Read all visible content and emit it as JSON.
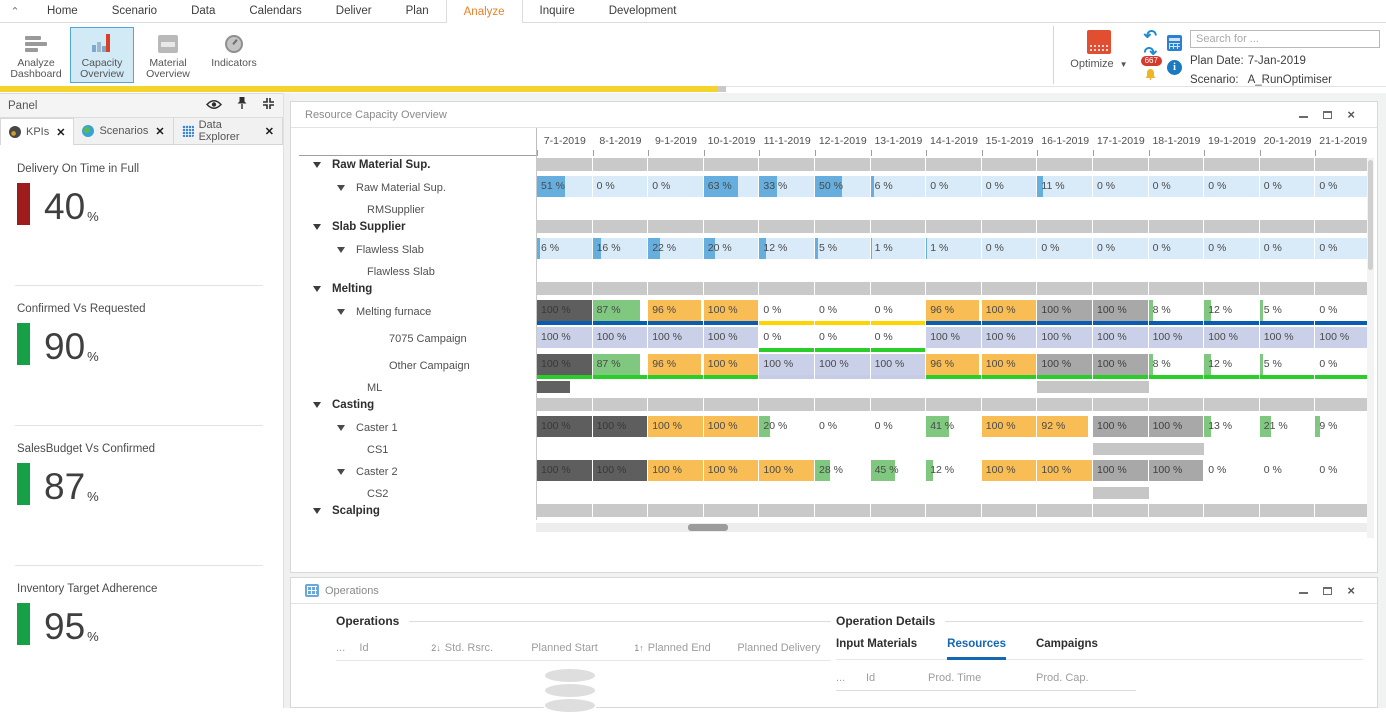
{
  "menubar": {
    "items": [
      "Home",
      "Scenario",
      "Data",
      "Calendars",
      "Deliver",
      "Plan",
      "Analyze",
      "Inquire",
      "Development"
    ],
    "active": "Analyze"
  },
  "ribbon": {
    "buttons": [
      {
        "label": "Analyze Dashboard",
        "icon": "dashboard-icon",
        "selected": false
      },
      {
        "label": "Capacity Overview",
        "icon": "capacity-chart-icon",
        "selected": true
      },
      {
        "label": "Material Overview",
        "icon": "material-box-icon",
        "selected": false
      },
      {
        "label": "Indicators",
        "icon": "gauge-icon",
        "selected": false
      }
    ],
    "optimize_label": "Optimize",
    "notification_badge": "667",
    "search_placeholder": "Search for ...",
    "plan_date_label": "Plan Date:",
    "plan_date_value": "7-Jan-2019",
    "scenario_label": "Scenario:",
    "scenario_value": "A_RunOptimiser"
  },
  "left_panel": {
    "title": "Panel",
    "tabs": [
      {
        "label": "KPIs",
        "icon": "kpi-gauge"
      },
      {
        "label": "Scenarios",
        "icon": "globe"
      },
      {
        "label": "Data Explorer",
        "icon": "data-grid"
      }
    ],
    "active_tab": "KPIs",
    "kpis": [
      {
        "label": "Delivery On Time in Full",
        "value": "40",
        "unit": "%",
        "color": "#9e1c1c"
      },
      {
        "label": "Confirmed Vs Requested",
        "value": "90",
        "unit": "%",
        "color": "#18a048"
      },
      {
        "label": "SalesBudget Vs Confirmed",
        "value": "87",
        "unit": "%",
        "color": "#18a048"
      },
      {
        "label": "Inventory Target Adherence",
        "value": "95",
        "unit": "%",
        "color": "#18a048"
      }
    ]
  },
  "capacity_panel": {
    "title": "Resource Capacity Overview",
    "dates": [
      "7-1-2019",
      "8-1-2019",
      "9-1-2019",
      "10-1-2019",
      "11-1-2019",
      "12-1-2019",
      "13-1-2019",
      "14-1-2019",
      "15-1-2019",
      "16-1-2019",
      "17-1-2019",
      "18-1-2019",
      "19-1-2019",
      "20-1-2019",
      "21-1-2019"
    ],
    "legend_colors": {
      "blue_track": "#d9ebf9",
      "blue_fill": "#66aede",
      "orange": "#f9bd55",
      "green": "#80c780",
      "gray": "#a8a8a8",
      "dark": "#5e5e5e",
      "lavender": "#cad0e8",
      "group_bar": "#c9c9c9",
      "underline_blue": "#0a5cb0",
      "underline_yellow": "#ffd400",
      "underline_green": "#2bcd2b",
      "underline_lavender": "#c6cbe6"
    },
    "rows": [
      {
        "kind": "group",
        "label": "Raw Material Sup."
      },
      {
        "kind": "capacity",
        "label": "Raw Material Sup.",
        "level": "resource",
        "cells": [
          {
            "v": 51,
            "s": "blue"
          },
          {
            "v": 0,
            "s": "blue"
          },
          {
            "v": 0,
            "s": "blue"
          },
          {
            "v": 63,
            "s": "blue"
          },
          {
            "v": 33,
            "s": "blue"
          },
          {
            "v": 50,
            "s": "blue"
          },
          {
            "v": 6,
            "s": "blue"
          },
          {
            "v": 0,
            "s": "blue"
          },
          {
            "v": 0,
            "s": "blue"
          },
          {
            "v": 11,
            "s": "blue"
          },
          {
            "v": 0,
            "s": "blue"
          },
          {
            "v": 0,
            "s": "blue"
          },
          {
            "v": 0,
            "s": "blue"
          },
          {
            "v": 0,
            "s": "blue"
          },
          {
            "v": 0,
            "s": "blue"
          }
        ]
      },
      {
        "kind": "name",
        "label": "RMSupplier",
        "segments": []
      },
      {
        "kind": "group",
        "label": "Slab Supplier"
      },
      {
        "kind": "capacity",
        "label": "Flawless Slab",
        "level": "resource",
        "cells": [
          {
            "v": 6,
            "s": "blue"
          },
          {
            "v": 16,
            "s": "blue"
          },
          {
            "v": 22,
            "s": "blue"
          },
          {
            "v": 20,
            "s": "blue"
          },
          {
            "v": 12,
            "s": "blue"
          },
          {
            "v": 5,
            "s": "blue"
          },
          {
            "v": 1,
            "s": "blue"
          },
          {
            "v": 1,
            "s": "blue"
          },
          {
            "v": 0,
            "s": "blue"
          },
          {
            "v": 0,
            "s": "blue"
          },
          {
            "v": 0,
            "s": "blue"
          },
          {
            "v": 0,
            "s": "blue"
          },
          {
            "v": 0,
            "s": "blue"
          },
          {
            "v": 0,
            "s": "blue"
          },
          {
            "v": 0,
            "s": "blue"
          }
        ]
      },
      {
        "kind": "name",
        "label": "Flawless Slab",
        "segments": []
      },
      {
        "kind": "group",
        "label": "Melting"
      },
      {
        "kind": "capacity",
        "label": "Melting furnace",
        "level": "resource",
        "cells": [
          {
            "v": 100,
            "s": "dark"
          },
          {
            "v": 87,
            "s": "green"
          },
          {
            "v": 96,
            "s": "orange"
          },
          {
            "v": 100,
            "s": "orange"
          },
          {
            "v": 0,
            "s": "plain"
          },
          {
            "v": 0,
            "s": "plain"
          },
          {
            "v": 0,
            "s": "plain"
          },
          {
            "v": 96,
            "s": "orange"
          },
          {
            "v": 100,
            "s": "orange"
          },
          {
            "v": 100,
            "s": "gray"
          },
          {
            "v": 100,
            "s": "gray"
          },
          {
            "v": 8,
            "s": "green"
          },
          {
            "v": 12,
            "s": "green"
          },
          {
            "v": 5,
            "s": "green"
          },
          {
            "v": 0,
            "s": "plain"
          }
        ],
        "underline": [
          "b",
          "b",
          "b",
          "b",
          "y",
          "y",
          "y",
          "b",
          "b",
          "b",
          "b",
          "b",
          "b",
          "b",
          "b"
        ]
      },
      {
        "kind": "capacity",
        "label": "7075 Campaign",
        "level": "campaign",
        "cells": [
          {
            "v": 100,
            "s": "lav"
          },
          {
            "v": 100,
            "s": "lav"
          },
          {
            "v": 100,
            "s": "lav"
          },
          {
            "v": 100,
            "s": "lav"
          },
          {
            "v": 0,
            "s": "plain"
          },
          {
            "v": 0,
            "s": "plain"
          },
          {
            "v": 0,
            "s": "plain"
          },
          {
            "v": 100,
            "s": "lav"
          },
          {
            "v": 100,
            "s": "lav"
          },
          {
            "v": 100,
            "s": "lav"
          },
          {
            "v": 100,
            "s": "lav"
          },
          {
            "v": 100,
            "s": "lav"
          },
          {
            "v": 100,
            "s": "lav"
          },
          {
            "v": 100,
            "s": "lav"
          },
          {
            "v": 100,
            "s": "lav"
          }
        ],
        "underline": [
          "",
          "",
          "",
          "",
          "g",
          "g",
          "g",
          "",
          "",
          "",
          "",
          "",
          "",
          "",
          ""
        ]
      },
      {
        "kind": "capacity",
        "label": "Other Campaign",
        "level": "campaign",
        "cells": [
          {
            "v": 100,
            "s": "dark"
          },
          {
            "v": 87,
            "s": "green"
          },
          {
            "v": 96,
            "s": "orange"
          },
          {
            "v": 100,
            "s": "orange"
          },
          {
            "v": 100,
            "s": "lav"
          },
          {
            "v": 100,
            "s": "lav"
          },
          {
            "v": 100,
            "s": "lav"
          },
          {
            "v": 96,
            "s": "orange"
          },
          {
            "v": 100,
            "s": "orange"
          },
          {
            "v": 100,
            "s": "gray"
          },
          {
            "v": 100,
            "s": "gray"
          },
          {
            "v": 8,
            "s": "green"
          },
          {
            "v": 12,
            "s": "green"
          },
          {
            "v": 5,
            "s": "green"
          },
          {
            "v": 0,
            "s": "plain"
          }
        ],
        "underline": [
          "g",
          "g",
          "g",
          "g",
          "l",
          "l",
          "l",
          "g",
          "g",
          "g",
          "g",
          "g",
          "g",
          "g",
          "g"
        ]
      },
      {
        "kind": "name",
        "label": "ML",
        "segments": [
          {
            "col": 0,
            "span": 1,
            "fill": 60,
            "tone": "dark"
          },
          {
            "col": 9,
            "span": 2,
            "fill": 100,
            "tone": "light"
          }
        ]
      },
      {
        "kind": "group",
        "label": "Casting"
      },
      {
        "kind": "capacity",
        "label": "Caster 1",
        "level": "resource",
        "cells": [
          {
            "v": 100,
            "s": "dark"
          },
          {
            "v": 100,
            "s": "dark"
          },
          {
            "v": 100,
            "s": "orange"
          },
          {
            "v": 100,
            "s": "orange"
          },
          {
            "v": 20,
            "s": "green"
          },
          {
            "v": 0,
            "s": "plain"
          },
          {
            "v": 0,
            "s": "plain"
          },
          {
            "v": 41,
            "s": "green"
          },
          {
            "v": 100,
            "s": "orange"
          },
          {
            "v": 92,
            "s": "orange"
          },
          {
            "v": 100,
            "s": "gray"
          },
          {
            "v": 100,
            "s": "gray"
          },
          {
            "v": 13,
            "s": "green"
          },
          {
            "v": 21,
            "s": "green"
          },
          {
            "v": 9,
            "s": "green"
          }
        ]
      },
      {
        "kind": "name",
        "label": "CS1",
        "segments": [
          {
            "col": 10,
            "span": 2,
            "fill": 100,
            "tone": "light"
          }
        ]
      },
      {
        "kind": "capacity",
        "label": "Caster 2",
        "level": "resource",
        "cells": [
          {
            "v": 100,
            "s": "dark"
          },
          {
            "v": 100,
            "s": "dark"
          },
          {
            "v": 100,
            "s": "orange"
          },
          {
            "v": 100,
            "s": "orange"
          },
          {
            "v": 100,
            "s": "orange"
          },
          {
            "v": 28,
            "s": "green"
          },
          {
            "v": 45,
            "s": "green"
          },
          {
            "v": 12,
            "s": "green"
          },
          {
            "v": 100,
            "s": "orange"
          },
          {
            "v": 100,
            "s": "orange"
          },
          {
            "v": 100,
            "s": "gray"
          },
          {
            "v": 100,
            "s": "gray"
          },
          {
            "v": 0,
            "s": "plain"
          },
          {
            "v": 0,
            "s": "plain"
          },
          {
            "v": 0,
            "s": "plain"
          }
        ]
      },
      {
        "kind": "name",
        "label": "CS2",
        "segments": [
          {
            "col": 10,
            "span": 1,
            "fill": 100,
            "tone": "light"
          }
        ]
      },
      {
        "kind": "group",
        "label": "Scalping"
      }
    ]
  },
  "operations_panel": {
    "title": "Operations",
    "left_section_title": "Operations",
    "columns": [
      {
        "sort": "",
        "label": "..."
      },
      {
        "sort": "",
        "label": "Id"
      },
      {
        "sort": "2↓",
        "label": "Std. Rsrc."
      },
      {
        "sort": "",
        "label": "Planned Start"
      },
      {
        "sort": "1↑",
        "label": "Planned End"
      },
      {
        "sort": "",
        "label": "Planned Delivery"
      }
    ],
    "details_section_title": "Operation Details",
    "detail_tabs": [
      "Input Materials",
      "Resources",
      "Campaigns"
    ],
    "active_detail_tab": "Resources",
    "detail_columns": [
      "...",
      "Id",
      "Prod. Time",
      "Prod. Cap."
    ]
  }
}
